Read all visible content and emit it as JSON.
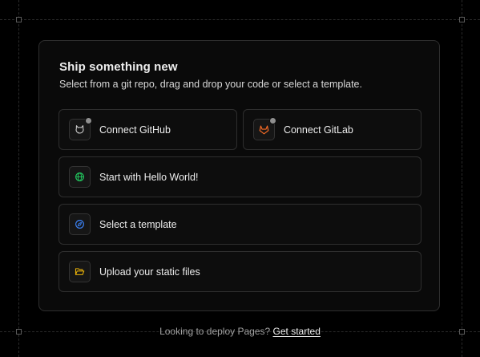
{
  "card": {
    "title": "Ship something new",
    "subtitle": "Select from a git repo, drag and drop your code or select a template."
  },
  "options": [
    {
      "label": "Connect GitHub",
      "icon": "github-icon",
      "status_dot": true
    },
    {
      "label": "Connect GitLab",
      "icon": "gitlab-icon",
      "status_dot": true
    },
    {
      "label": "Start with Hello World!",
      "icon": "globe-icon",
      "icon_color": "#22c55e"
    },
    {
      "label": "Select a template",
      "icon": "compass-icon",
      "icon_color": "#3b82f6"
    },
    {
      "label": "Upload your static files",
      "icon": "folder-open-icon",
      "icon_color": "#eab308"
    }
  ],
  "footer": {
    "text": "Looking to deploy Pages?",
    "link": "Get started"
  },
  "colors": {
    "background": "#000000",
    "card": "#0a0a0a",
    "border": "#2e2e2e",
    "gitlab": "#fc6d26"
  }
}
